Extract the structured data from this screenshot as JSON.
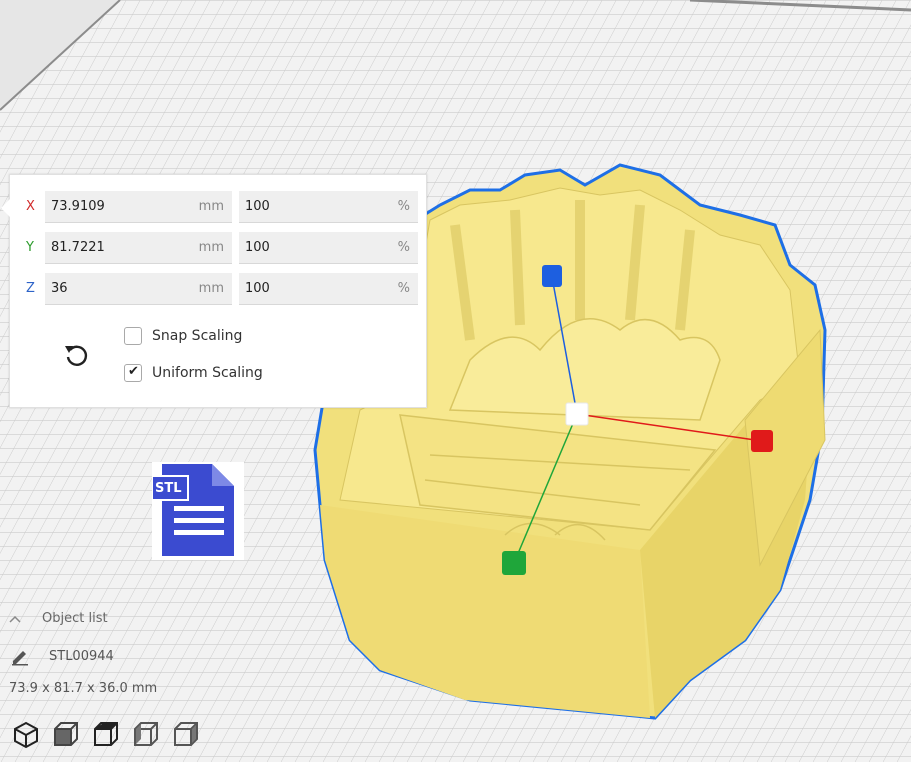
{
  "scale_panel": {
    "x": {
      "axis": "X",
      "value": "73.9109",
      "unit": "mm",
      "percent": "100",
      "percent_unit": "%",
      "color": "#d12b2b"
    },
    "y": {
      "axis": "Y",
      "value": "81.7221",
      "unit": "mm",
      "percent": "100",
      "percent_unit": "%",
      "color": "#2c9b2c"
    },
    "z": {
      "axis": "Z",
      "value": "36",
      "unit": "mm",
      "percent": "100",
      "percent_unit": "%",
      "color": "#2d63c8"
    },
    "snap_scaling": {
      "label": "Snap Scaling",
      "checked": false
    },
    "uniform_scaling": {
      "label": "Uniform Scaling",
      "checked": true
    },
    "reset_icon": "reset-icon"
  },
  "stl_icon": {
    "label": "STL",
    "color": "#3b4bd0"
  },
  "object_list": {
    "header": "Object list",
    "item": "STL00944",
    "dimensions": "73.9 x 81.7 x 36.0 mm"
  },
  "view_buttons": [
    "3d-view-icon",
    "front-view-icon",
    "top-view-icon",
    "left-view-icon",
    "right-view-icon"
  ],
  "colors": {
    "model": "#f5e483",
    "outline": "#1e6fe6",
    "handle_x": "#e01a1a",
    "handle_y": "#1fa63a",
    "handle_z": "#1d5fe0"
  }
}
